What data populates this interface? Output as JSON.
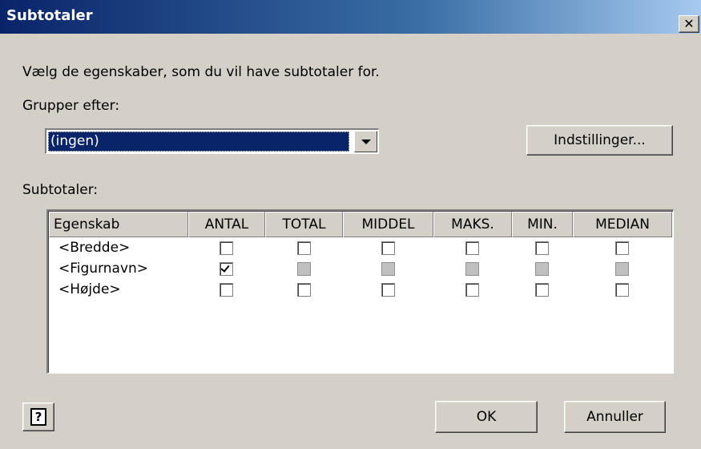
{
  "window": {
    "title": "Subtotaler",
    "close_label": "✕"
  },
  "dialog": {
    "instruction": "Vælg de egenskaber, som du vil have subtotaler for.",
    "group_by_label": "Grupper efter:",
    "group_by_value": "(ingen)",
    "settings_button": "Indstillinger...",
    "subtotals_label": "Subtotaler:",
    "ok_button": "OK",
    "cancel_button": "Annuller",
    "help_icon": "?"
  },
  "table": {
    "columns": [
      "Egenskab",
      "ANTAL",
      "TOTAL",
      "MIDDEL",
      "MAKS.",
      "MIN.",
      "MEDIAN"
    ],
    "rows": [
      {
        "label": "<Bredde>",
        "checks": [
          false,
          false,
          false,
          false,
          false,
          false
        ],
        "disabled": [
          false,
          false,
          false,
          false,
          false,
          false
        ]
      },
      {
        "label": "<Figurnavn>",
        "checks": [
          true,
          false,
          false,
          false,
          false,
          false
        ],
        "disabled": [
          false,
          true,
          true,
          true,
          true,
          true
        ]
      },
      {
        "label": "<Højde>",
        "checks": [
          false,
          false,
          false,
          false,
          false,
          false
        ],
        "disabled": [
          false,
          false,
          false,
          false,
          false,
          false
        ]
      }
    ]
  }
}
